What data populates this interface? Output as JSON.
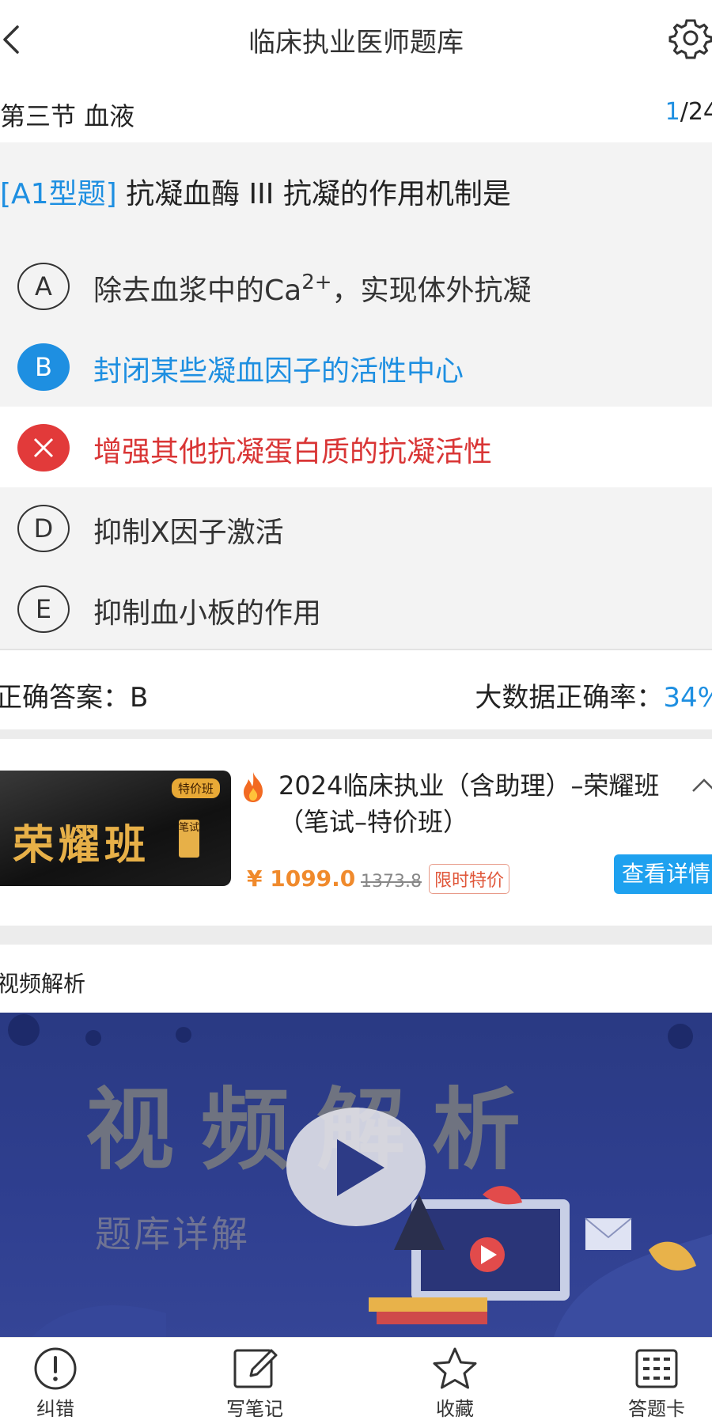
{
  "header": {
    "title": "临床执业医师题库"
  },
  "section": {
    "title": "第三节 血液",
    "current": "1",
    "total": "/24"
  },
  "question": {
    "type": "[A1型题]",
    "text": "抗凝血酶 III 抗凝的作用机制是"
  },
  "options": [
    {
      "letter": "A",
      "text": "除去血浆中的Ca",
      "superscript": "2+",
      "suffix": "，实现体外抗凝",
      "state": "normal"
    },
    {
      "letter": "B",
      "text": "封闭某些凝血因子的活性中心",
      "state": "correct-selected"
    },
    {
      "letter": "✕",
      "text": "增强其他抗凝蛋白质的抗凝活性",
      "state": "wrong-selected"
    },
    {
      "letter": "D",
      "text": "抑制Ⅹ因子激活",
      "state": "normal"
    },
    {
      "letter": "E",
      "text": "抑制血小板的作用",
      "state": "normal"
    }
  ],
  "answer": {
    "label": "正确答案：B",
    "rate_label": "大数据正确率：",
    "rate_value": "34%"
  },
  "ad": {
    "banner_tag": "特价班",
    "banner_big": "荣耀班",
    "banner_small": "笔试",
    "title": "2024临床执业（含助理）–荣耀班（笔试–特价班）",
    "price": "¥ 1099.0",
    "old_price": "1373.8",
    "badge": "限时特价",
    "detail_button": "查看详情"
  },
  "video": {
    "label": "视频解析",
    "heading": "视频解析",
    "subheading": "题库详解"
  },
  "tabs": [
    {
      "label": "纠错",
      "icon": "alert-icon"
    },
    {
      "label": "写笔记",
      "icon": "edit-note-icon"
    },
    {
      "label": "收藏",
      "icon": "star-icon"
    },
    {
      "label": "答题卡",
      "icon": "answer-card-icon"
    }
  ],
  "colors": {
    "accent": "#1e8fe1",
    "wrong": "#e23a3a",
    "price": "#f08a2c"
  }
}
